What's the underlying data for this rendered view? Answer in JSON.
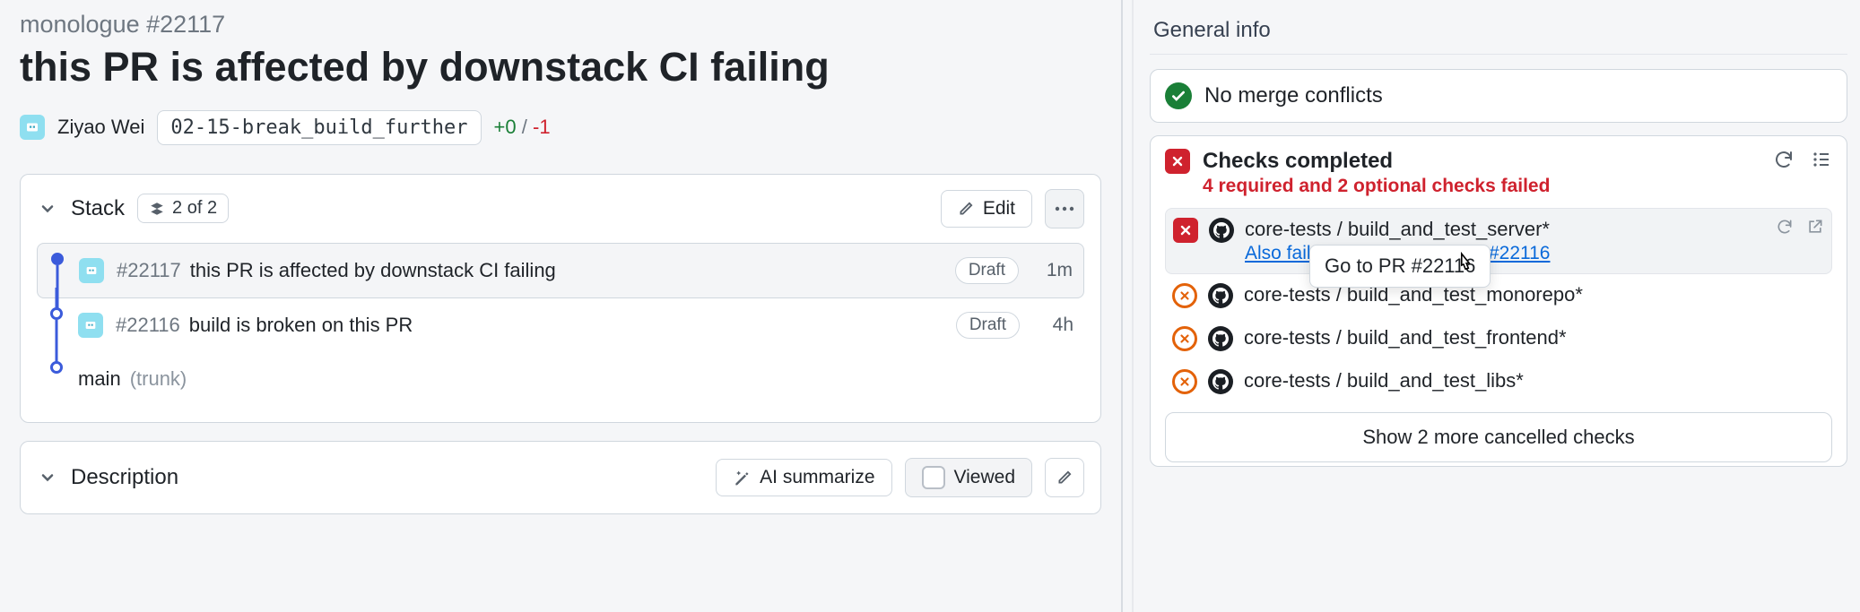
{
  "header": {
    "breadcrumb": "monologue #22117",
    "title": "this PR is affected by downstack CI failing",
    "author": "Ziyao Wei",
    "branch": "02-15-break_build_further",
    "additions": "+0",
    "slash": "/",
    "deletions": "-1"
  },
  "stack": {
    "title": "Stack",
    "count": "2 of 2",
    "edit": "Edit",
    "rows": [
      {
        "num": "#22117",
        "title": "this PR is affected by downstack CI failing",
        "badge": "Draft",
        "age": "1m"
      },
      {
        "num": "#22116",
        "title": "build is broken on this PR",
        "badge": "Draft",
        "age": "4h"
      }
    ],
    "base_branch": "main",
    "base_suffix": "(trunk)"
  },
  "description": {
    "title": "Description",
    "ai_button": "AI summarize",
    "viewed": "Viewed"
  },
  "sidebar": {
    "title": "General info",
    "merge_status": "No merge conflicts",
    "checks": {
      "title": "Checks completed",
      "subtitle": "4 required and 2 optional checks failed",
      "items": [
        {
          "name": "core-tests / build_and_test_server*",
          "sub_link": "Also failed on downstack PR #22116"
        },
        {
          "name": "core-tests / build_and_test_monorepo*"
        },
        {
          "name": "core-tests / build_and_test_frontend*"
        },
        {
          "name": "core-tests / build_and_test_libs*"
        }
      ],
      "tooltip": "Go to PR #22116",
      "show_more": "Show 2 more cancelled checks"
    }
  }
}
